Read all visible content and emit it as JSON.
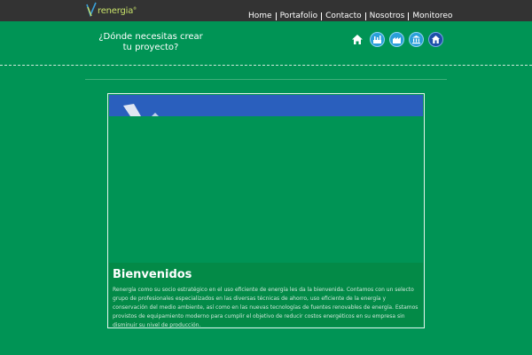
{
  "header": {
    "logo_text": "renergia",
    "logo_sup": "®",
    "nav": [
      {
        "label": "Home"
      },
      {
        "label": "Portafolio"
      },
      {
        "label": "Contacto"
      },
      {
        "label": "Nosotros"
      },
      {
        "label": "Monitoreo"
      }
    ]
  },
  "hero": {
    "question": "¿Dónde necesitas crear tu proyecto?",
    "project_icons": [
      {
        "icon": "home-icon"
      },
      {
        "icon": "industry-icon"
      },
      {
        "icon": "factory-icon"
      },
      {
        "icon": "government-building-icon"
      },
      {
        "icon": "house-icon"
      }
    ]
  },
  "welcome": {
    "title": "Bienvenidos",
    "body": "Renergía como su socio estratégico en el uso eficiente de energía les da la bienvenida. Contamos con un selecto grupo de profesionales especializados en las diversas técnicas de ahorro, uso eficiente de la energía y conservación del medio ambiente, así como en las nuevas tecnologías de fuentes renovables de energía. Estamos provistos de equipamiento moderno para cumplir el objetivo de reducir costos energéticos en su empresa sin disminuir su nivel de producción."
  },
  "colors": {
    "page_background": "#009455",
    "top_bar": "#333333",
    "banner_blue": "#2a5fbd",
    "icon_blue": "#2a9fd9",
    "icon_dark_blue": "#1d4fa8",
    "logo_green": "#c8e26a"
  }
}
